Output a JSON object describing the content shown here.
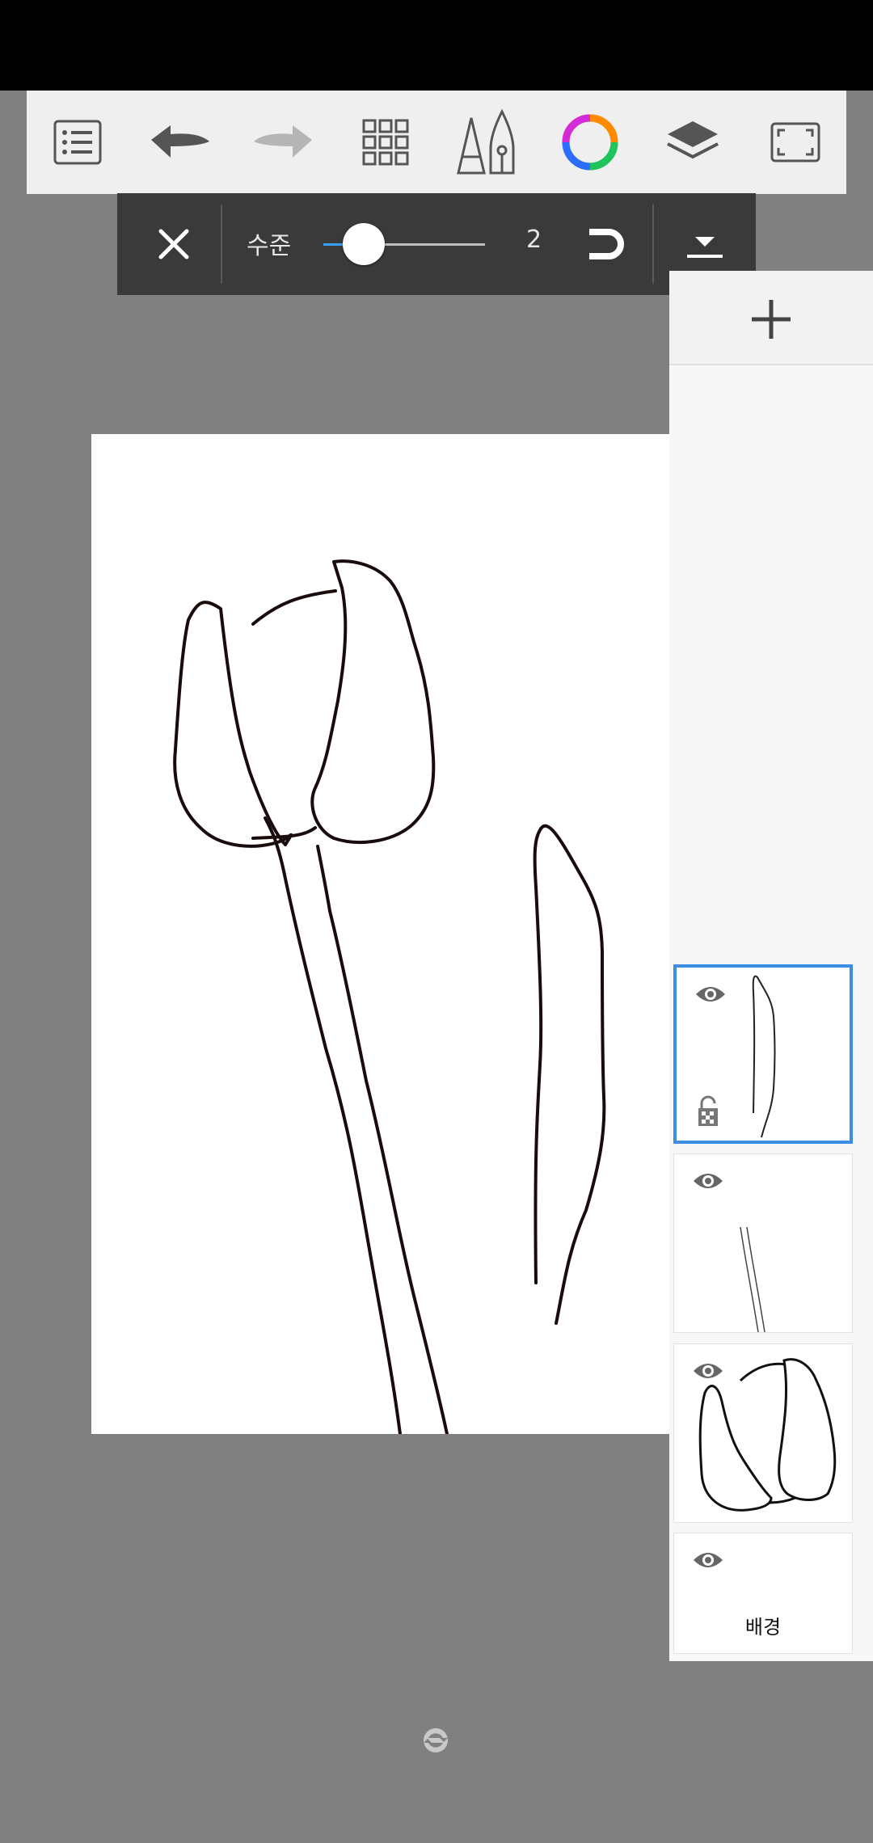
{
  "toolbar": {
    "items": [
      {
        "id": "menu",
        "icon": "list-menu-icon"
      },
      {
        "id": "undo",
        "icon": "undo-icon"
      },
      {
        "id": "redo",
        "icon": "redo-icon"
      },
      {
        "id": "grid",
        "icon": "grid-icon"
      },
      {
        "id": "brush",
        "icon": "brush-pen-icon"
      },
      {
        "id": "color",
        "icon": "color-wheel-icon"
      },
      {
        "id": "layers",
        "icon": "layers-icon"
      },
      {
        "id": "fullscreen",
        "icon": "fullscreen-icon"
      }
    ]
  },
  "subbar": {
    "level_label": "수준",
    "level_value": "2",
    "slider_fraction": 0.25,
    "accent_color": "#3aa0ff"
  },
  "layers": {
    "items": [
      {
        "id": "layer-leaf",
        "selected": true,
        "name": ""
      },
      {
        "id": "layer-stem",
        "selected": false,
        "name": ""
      },
      {
        "id": "layer-flower",
        "selected": false,
        "name": ""
      },
      {
        "id": "layer-background",
        "selected": false,
        "name": "배경"
      }
    ],
    "selected_color": "#3d8fe6"
  }
}
